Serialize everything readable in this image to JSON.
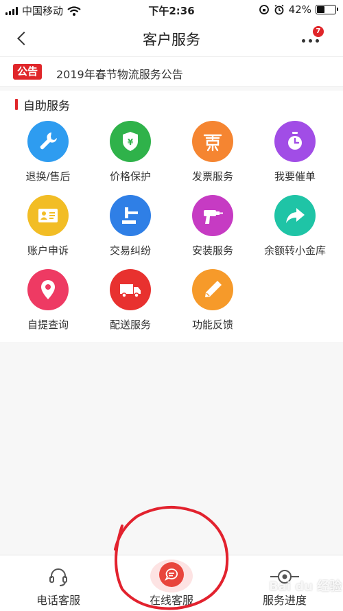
{
  "status_bar": {
    "carrier": "中国移动",
    "time": "下午2:36",
    "battery_percent": "42%"
  },
  "nav": {
    "title": "客户服务",
    "badge_count": "7"
  },
  "notice": {
    "tag": "公告",
    "text": "2019年春节物流服务公告"
  },
  "section": {
    "title": "自助服务"
  },
  "services": [
    {
      "label": "退换/售后",
      "icon": "wrench-icon",
      "color": "#2e9cf0"
    },
    {
      "label": "价格保护",
      "icon": "price-shield-icon",
      "color": "#2fb24a"
    },
    {
      "label": "发票服务",
      "icon": "invoice-icon",
      "color": "#f58531"
    },
    {
      "label": "我要催单",
      "icon": "timer-icon",
      "color": "#a14de6"
    },
    {
      "label": "账户申诉",
      "icon": "id-card-icon",
      "color": "#f2bd25"
    },
    {
      "label": "交易纠纷",
      "icon": "gavel-icon",
      "color": "#2f7fe6"
    },
    {
      "label": "安装服务",
      "icon": "drill-icon",
      "color": "#c63bc3"
    },
    {
      "label": "余额转小金库",
      "icon": "share-arrow-icon",
      "color": "#1fc4a6"
    },
    {
      "label": "自提查询",
      "icon": "location-pin-icon",
      "color": "#ee3a63"
    },
    {
      "label": "配送服务",
      "icon": "delivery-truck-icon",
      "color": "#e8312f"
    },
    {
      "label": "功能反馈",
      "icon": "pencil-icon",
      "color": "#f69a2a"
    }
  ],
  "bottom_tabs": {
    "phone": "电话客服",
    "online": "在线客服",
    "progress": "服务进度"
  },
  "watermark": "Bai du 经验",
  "colors": {
    "accent_red": "#e0262a",
    "background": "#f7f7f7"
  }
}
